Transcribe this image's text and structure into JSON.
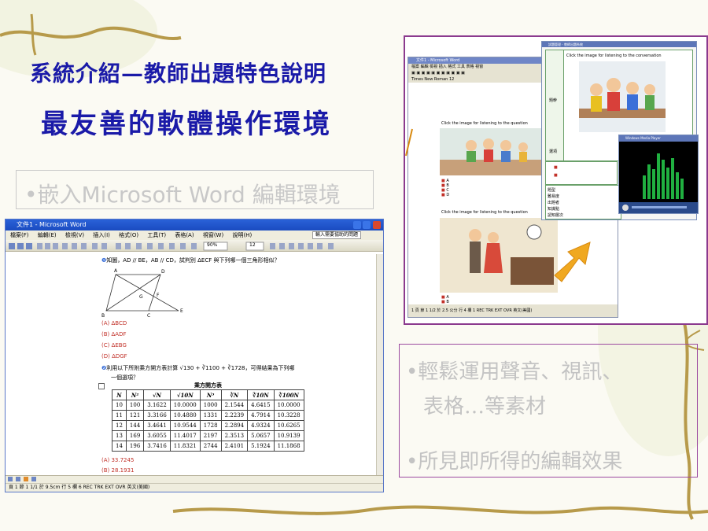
{
  "slide": {
    "title_line1": "系統介紹—教師出題特色說明",
    "title_line2": "最友善的軟體操作環境",
    "bullet1": "•嵌入Microsoft Word 編輯環境",
    "bullet2_line1": "•輕鬆運用聲音、視訊、",
    "bullet2_line2": "表格…等素材",
    "bullet3": "•所見即所得的編輯效果"
  },
  "word_left": {
    "window_title": "文件1 - Microsoft Word",
    "menu": [
      "檔案(F)",
      "編輯(E)",
      "檢視(V)",
      "插入(I)",
      "格式(O)",
      "工具(T)",
      "表格(A)",
      "視窗(W)",
      "說明(H)"
    ],
    "help_box": "輸入需要協助的問題",
    "zoom": "90%",
    "font_size": "12",
    "question1": "知圖，AD // BE，AB // CD，試判別 ΔECF 與下列哪一個三角形相似？",
    "figure_labels": [
      "A",
      "D",
      "G",
      "F",
      "B",
      "C",
      "E"
    ],
    "options1": [
      "(A) ΔBCD",
      "(B) ΔADF",
      "(C) ΔEBG",
      "(D) ΔDGF"
    ],
    "question2_line1": "利用以下所附乘方開方表計算 √130 + ∛1100 + ∛1728，可得結果為下列哪",
    "question2_line2": "一個選項？",
    "table_title": "乘方開方表",
    "table_headers": [
      "N",
      "N²",
      "√N",
      "√10N",
      "N³",
      "∛N",
      "∛10N",
      "∛100N"
    ],
    "table_rows": [
      [
        "10",
        "100",
        "3.1622",
        "10.0000",
        "1000",
        "2.1544",
        "4.6415",
        "10.0000"
      ],
      [
        "11",
        "121",
        "3.3166",
        "10.4880",
        "1331",
        "2.2239",
        "4.7914",
        "10.3228"
      ],
      [
        "12",
        "144",
        "3.4641",
        "10.9544",
        "1728",
        "2.2894",
        "4.9324",
        "10.6265"
      ],
      [
        "13",
        "169",
        "3.6055",
        "11.4017",
        "2197",
        "2.3513",
        "5.0657",
        "10.9139"
      ],
      [
        "14",
        "196",
        "3.7416",
        "11.8321",
        "2744",
        "2.4101",
        "5.1924",
        "11.1868"
      ]
    ],
    "options2": [
      "(A) 33.7245",
      "(B) 28.1931"
    ],
    "status": "頁 1   節 1      1/1   於 9.5cm   行 5   欄 6      REC  TRK  EXT  OVR   英文(美國)"
  },
  "word_right": {
    "window_title": "文件1 - Microsoft Word",
    "font_name": "Times New Roman",
    "font_size": "12",
    "prompt1": "Click the image for listening to the question",
    "prompt2": "Click the image for listening to the question",
    "answer_marks": [
      "A",
      "B",
      "C",
      "D",
      "E"
    ],
    "status": "1 頁  節 1   1/2   於 2.5 公分  行 4  欄 1   REC  TRK  EXT  OVR  英文(美國)"
  },
  "test_window": {
    "title": "試題管理 - 教師出題系統",
    "prompt": "Click the image for listening to the conversation",
    "labels": [
      "題幹",
      "選項"
    ],
    "info_labels": [
      "題型",
      "難易度",
      "出題者",
      "知識點",
      "認知層次"
    ]
  },
  "media_player": {
    "title": "Windows Media Player"
  },
  "colors": {
    "title_blue": "#1a1aa8",
    "frame_purple": "#8b3a8e",
    "option_red": "#c2322a",
    "accent_gold": "#f0a820"
  }
}
